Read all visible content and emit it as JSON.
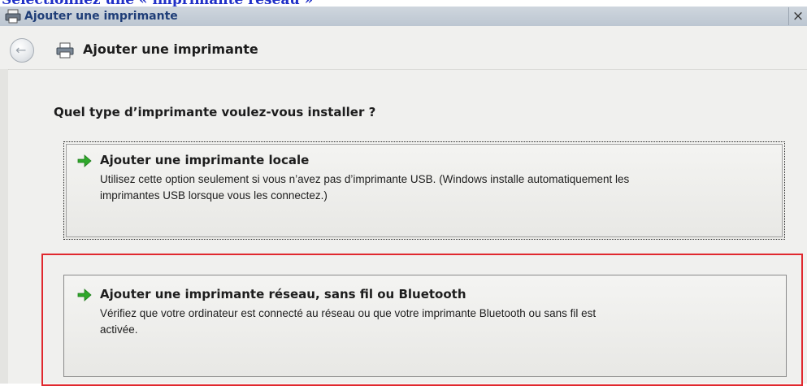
{
  "page_caption": "Sélectionnez une « imprimante réseau »",
  "window": {
    "title": "Ajouter une imprimante",
    "close_label": "×",
    "icon": "printer-icon"
  },
  "navbar": {
    "title": "Ajouter une imprimante",
    "back_icon": "back-arrow-icon",
    "icon": "printer-icon"
  },
  "main": {
    "question": "Quel type d’imprimante voulez-vous installer ?",
    "options": [
      {
        "title": "Ajouter une imprimante locale",
        "description_line1": "Utilisez cette option seulement si vous n’avez pas d’imprimante USB. (Windows installe automatiquement les",
        "description_line2": "imprimantes USB lorsque vous les connectez.)",
        "icon": "green-arrow-icon"
      },
      {
        "title": "Ajouter une imprimante réseau, sans fil ou Bluetooth",
        "description_line1": "Vérifiez que votre ordinateur est connecté au réseau ou que votre imprimante Bluetooth ou sans fil est",
        "description_line2": "activée.",
        "icon": "green-arrow-icon"
      }
    ]
  },
  "colors": {
    "highlight": "#e0282e",
    "caption": "#2030c8",
    "arrow": "#2fa82b"
  }
}
